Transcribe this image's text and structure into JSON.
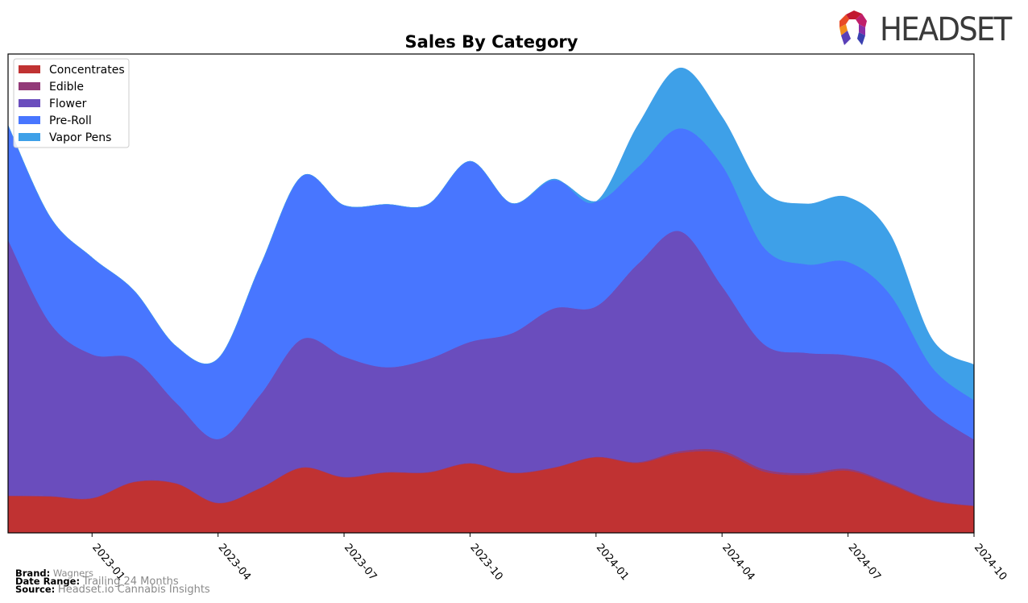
{
  "logo": {
    "text": "HEADSET"
  },
  "footer": {
    "brand_label": "Brand:",
    "brand_value": "Wagners",
    "range_label": "Date Range:",
    "range_value": "Trailing 24 Months",
    "source_label": "Source:",
    "source_value": "Headset.io Cannabis Insights"
  },
  "chart_data": {
    "type": "area",
    "stacked": true,
    "title": "Sales By Category",
    "xlabel": "",
    "ylabel": "",
    "y_units": "relative (no y-axis shown)",
    "ylim": [
      0,
      100
    ],
    "grid": false,
    "legend_position": "top-left",
    "x": [
      "2022-11",
      "2022-12",
      "2023-01",
      "2023-02",
      "2023-03",
      "2023-04",
      "2023-05",
      "2023-06",
      "2023-07",
      "2023-08",
      "2023-09",
      "2023-10",
      "2023-11",
      "2023-12",
      "2024-01",
      "2024-02",
      "2024-03",
      "2024-04",
      "2024-05",
      "2024-06",
      "2024-07",
      "2024-08",
      "2024-09",
      "2024-10"
    ],
    "xticks": [
      "2023-01",
      "2023-04",
      "2023-07",
      "2023-10",
      "2024-01",
      "2024-04",
      "2024-07",
      "2024-10"
    ],
    "series": [
      {
        "name": "Concentrates",
        "color": "#c03232",
        "values": [
          7.7,
          7.6,
          7.2,
          10.6,
          10.3,
          6.2,
          9.3,
          13.6,
          11.6,
          12.6,
          12.6,
          14.5,
          12.5,
          13.6,
          15.8,
          14.6,
          16.7,
          16.7,
          12.8,
          12.1,
          13.0,
          10.1,
          6.7,
          5.6
        ]
      },
      {
        "name": "Edible",
        "color": "#923a78",
        "values": [
          0.1,
          0.1,
          0.1,
          0.1,
          0.1,
          0.1,
          0.1,
          0.1,
          0.1,
          0.1,
          0.1,
          0.1,
          0.1,
          0.1,
          0.1,
          0.2,
          0.4,
          0.5,
          0.5,
          0.4,
          0.4,
          0.3,
          0.2,
          0.1
        ]
      },
      {
        "name": "Flower",
        "color": "#6a4dbd",
        "values": [
          53.4,
          36.1,
          30.0,
          25.6,
          16.8,
          13.3,
          19.4,
          26.8,
          25.1,
          21.9,
          23.6,
          25.3,
          29.1,
          33.2,
          31.4,
          41.4,
          45.9,
          34.3,
          26.1,
          25.1,
          23.7,
          24.3,
          18.4,
          13.8
        ]
      },
      {
        "name": "Pre-Roll",
        "color": "#4876ff",
        "values": [
          23.9,
          22.2,
          20.2,
          14.3,
          11.8,
          16.8,
          26.9,
          34.0,
          31.6,
          34.0,
          32.3,
          37.7,
          27.1,
          26.8,
          21.9,
          20.2,
          21.5,
          25.3,
          20.2,
          18.5,
          19.5,
          15.1,
          9.3,
          8.2
        ]
      },
      {
        "name": "Vapor Pens",
        "color": "#3ea0e8",
        "values": [
          0,
          0,
          0,
          0,
          0,
          0,
          0,
          0,
          0,
          0,
          0,
          0,
          0,
          0.2,
          0,
          8.8,
          12.6,
          10.1,
          11.8,
          12.6,
          13.5,
          12.6,
          5.9,
          7.4
        ]
      }
    ]
  }
}
